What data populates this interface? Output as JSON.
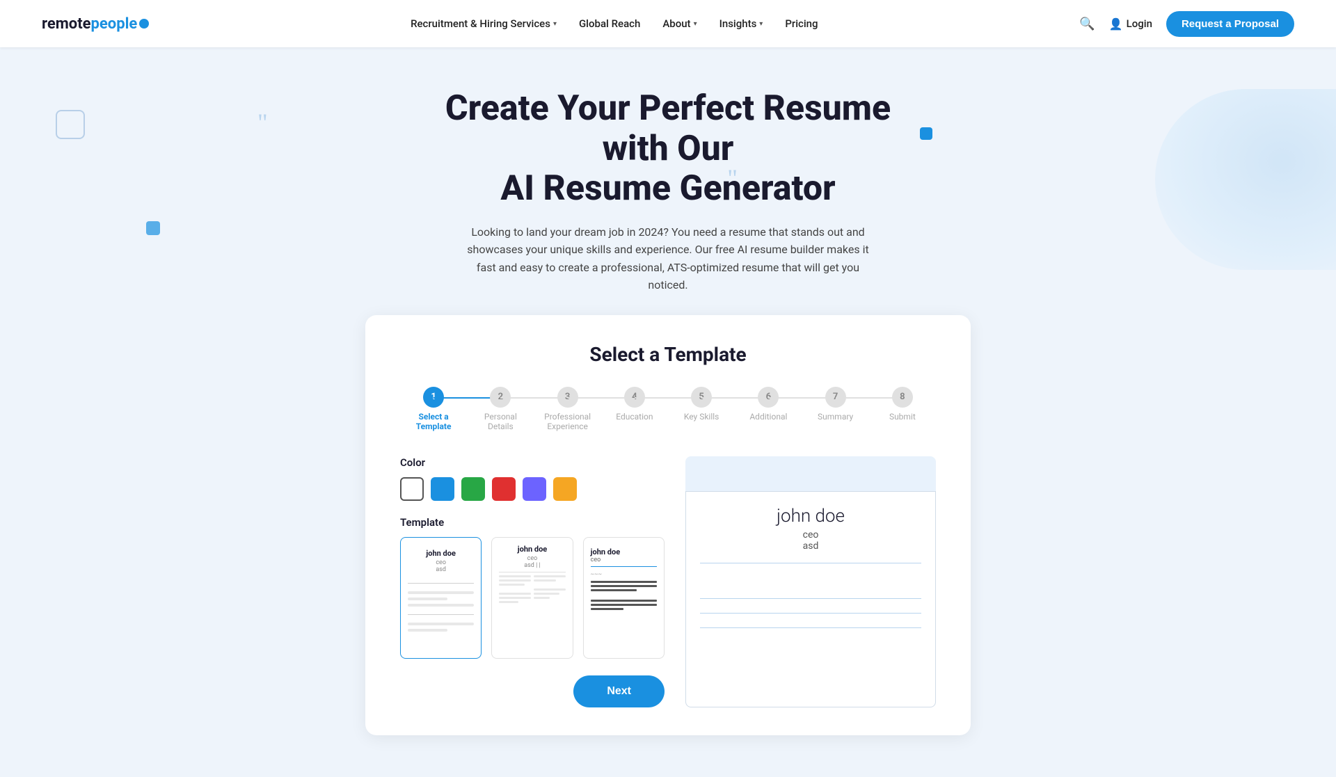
{
  "nav": {
    "logo_remote": "remote",
    "logo_people": "people",
    "links": [
      {
        "label": "Recruitment & Hiring Services",
        "has_dropdown": true
      },
      {
        "label": "Global Reach",
        "has_dropdown": false
      },
      {
        "label": "About",
        "has_dropdown": true
      },
      {
        "label": "Insights",
        "has_dropdown": true
      },
      {
        "label": "Pricing",
        "has_dropdown": false
      }
    ],
    "login_label": "Login",
    "proposal_label": "Request a Proposal"
  },
  "hero": {
    "title_line1": "Create Your Perfect Resume with Our",
    "title_line2": "AI Resume Generator",
    "description": "Looking to land your dream job in 2024? You need a resume that stands out and showcases your unique skills and experience. Our free AI resume builder makes it fast and easy to create a professional, ATS-optimized resume that will get you noticed."
  },
  "card": {
    "title": "Select a Template",
    "stepper": [
      {
        "num": "1",
        "label": "Select a Template",
        "active": true
      },
      {
        "num": "2",
        "label": "Personal Details",
        "active": false
      },
      {
        "num": "3",
        "label": "Professional Experience",
        "active": false
      },
      {
        "num": "4",
        "label": "Education",
        "active": false
      },
      {
        "num": "5",
        "label": "Key Skills",
        "active": false
      },
      {
        "num": "6",
        "label": "Additional",
        "active": false
      },
      {
        "num": "7",
        "label": "Summary",
        "active": false
      },
      {
        "num": "8",
        "label": "Submit",
        "active": false
      }
    ],
    "color_label": "Color",
    "template_label": "Template",
    "colors": [
      "white",
      "blue",
      "green",
      "red",
      "purple",
      "orange"
    ],
    "templates": [
      {
        "id": 1,
        "name": "john doe",
        "title": "ceo",
        "subtitle": "asd",
        "style": "simple"
      },
      {
        "id": 2,
        "name": "john doe",
        "title": "ceo",
        "subtitle": "asd | |",
        "style": "two-col"
      },
      {
        "id": 3,
        "name": "john doe",
        "title": "ceo",
        "subtitle": "",
        "style": "modern"
      }
    ],
    "preview": {
      "name": "john doe",
      "title": "ceo",
      "company": "asd"
    },
    "next_button": "Next"
  }
}
